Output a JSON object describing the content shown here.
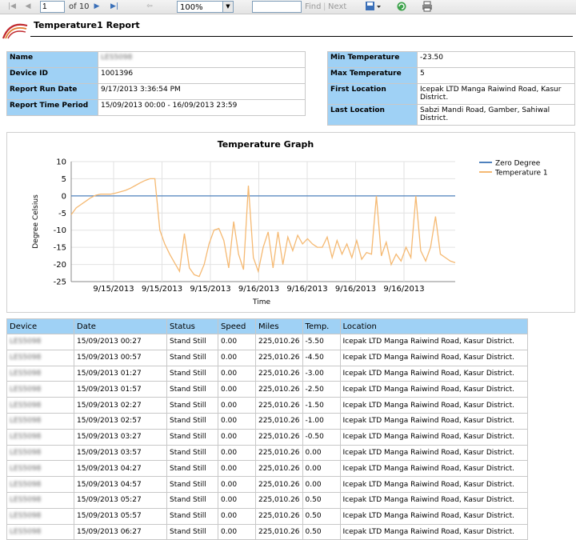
{
  "toolbar": {
    "page_value": "1",
    "page_of": "of 10",
    "zoom_value": "100%",
    "find_placeholder": "",
    "find_label": "Find",
    "separator": "|",
    "next_label": "Next"
  },
  "report": {
    "title": "Temperature1 Report"
  },
  "info_left": [
    {
      "label": "Name",
      "value": "LES5098"
    },
    {
      "label": "Device ID",
      "value": "1001396"
    },
    {
      "label": "Report Run Date",
      "value": "9/17/2013 3:36:54 PM"
    },
    {
      "label": "Report Time Period",
      "value": "15/09/2013 00:00 - 16/09/2013 23:59"
    }
  ],
  "info_right": [
    {
      "label": "Min Temperature",
      "value": "-23.50"
    },
    {
      "label": "Max Temperature",
      "value": "5"
    },
    {
      "label": "First Location",
      "value": "Icepak LTD Manga Raiwind Road, Kasur District."
    },
    {
      "label": "Last Location",
      "value": "Sabzi Mandi Road, Gamber, Sahiwal District."
    }
  ],
  "chart_data": {
    "type": "line",
    "title": "Temperature Graph",
    "xlabel": "Time",
    "ylabel": "Degree Celsius",
    "ylim": [
      -25,
      10
    ],
    "yticks": [
      10,
      5,
      0,
      -5,
      -10,
      -15,
      -20,
      -25
    ],
    "xtick_labels": [
      "9/15/2013",
      "9/15/2013",
      "9/15/2013",
      "9/16/2013",
      "9/16/2013",
      "9/16/2013",
      "9/16/2013"
    ],
    "legend_position": "top-right",
    "grid": true,
    "series": [
      {
        "name": "Zero Degree",
        "color": "#4f81bd",
        "values": [
          0,
          0
        ]
      },
      {
        "name": "Temperature 1",
        "color": "#f5b972",
        "values": [
          -5.5,
          -3.5,
          -2.5,
          -1.5,
          -0.5,
          0.2,
          0.5,
          0.5,
          0.5,
          0.8,
          1.2,
          1.6,
          2.2,
          3.0,
          3.8,
          4.5,
          5.0,
          5.0,
          -10.0,
          -14.0,
          -17.0,
          -19.5,
          -22.0,
          -11.0,
          -21.0,
          -23.0,
          -23.5,
          -20.0,
          -14.0,
          -10.0,
          -9.5,
          -13.0,
          -21.0,
          -7.5,
          -17.0,
          -21.5,
          3.0,
          -18.0,
          -22.0,
          -15.0,
          -10.5,
          -21.0,
          -10.5,
          -20.0,
          -12.0,
          -16.0,
          -11.5,
          -14.0,
          -12.5,
          -14.0,
          -15.0,
          -15.0,
          -12.0,
          -18.0,
          -13.0,
          -17.0,
          -14.0,
          -18.0,
          -13.0,
          -18.5,
          -16.5,
          -17.0,
          0.0,
          -17.5,
          -13.5,
          -20.0,
          -17.0,
          -19.0,
          -15.0,
          -18.0,
          0.0,
          -16.0,
          -19.0,
          -15.0,
          -6.0,
          -17.0,
          -18.0,
          -19.0,
          -19.5
        ]
      }
    ]
  },
  "table": {
    "headers": [
      "Device",
      "Date",
      "Status",
      "Speed",
      "Miles",
      "Temp.",
      "Location"
    ],
    "rows": [
      [
        "LES5098",
        "15/09/2013 00:27",
        "Stand Still",
        "0.00",
        "225,010.26",
        "-5.50",
        "Icepak LTD Manga Raiwind Road, Kasur District."
      ],
      [
        "LES5098",
        "15/09/2013 00:57",
        "Stand Still",
        "0.00",
        "225,010.26",
        "-4.50",
        "Icepak LTD Manga Raiwind Road, Kasur District."
      ],
      [
        "LES5098",
        "15/09/2013 01:27",
        "Stand Still",
        "0.00",
        "225,010.26",
        "-3.00",
        "Icepak LTD Manga Raiwind Road, Kasur District."
      ],
      [
        "LES5098",
        "15/09/2013 01:57",
        "Stand Still",
        "0.00",
        "225,010.26",
        "-2.50",
        "Icepak LTD Manga Raiwind Road, Kasur District."
      ],
      [
        "LES5098",
        "15/09/2013 02:27",
        "Stand Still",
        "0.00",
        "225,010.26",
        "-1.50",
        "Icepak LTD Manga Raiwind Road, Kasur District."
      ],
      [
        "LES5098",
        "15/09/2013 02:57",
        "Stand Still",
        "0.00",
        "225,010.26",
        "-1.00",
        "Icepak LTD Manga Raiwind Road, Kasur District."
      ],
      [
        "LES5098",
        "15/09/2013 03:27",
        "Stand Still",
        "0.00",
        "225,010.26",
        "-0.50",
        "Icepak LTD Manga Raiwind Road, Kasur District."
      ],
      [
        "LES5098",
        "15/09/2013 03:57",
        "Stand Still",
        "0.00",
        "225,010.26",
        "0.00",
        "Icepak LTD Manga Raiwind Road, Kasur District."
      ],
      [
        "LES5098",
        "15/09/2013 04:27",
        "Stand Still",
        "0.00",
        "225,010.26",
        "0.00",
        "Icepak LTD Manga Raiwind Road, Kasur District."
      ],
      [
        "LES5098",
        "15/09/2013 04:57",
        "Stand Still",
        "0.00",
        "225,010.26",
        "0.00",
        "Icepak LTD Manga Raiwind Road, Kasur District."
      ],
      [
        "LES5098",
        "15/09/2013 05:27",
        "Stand Still",
        "0.00",
        "225,010.26",
        "0.50",
        "Icepak LTD Manga Raiwind Road, Kasur District."
      ],
      [
        "LES5098",
        "15/09/2013 05:57",
        "Stand Still",
        "0.00",
        "225,010.26",
        "0.50",
        "Icepak LTD Manga Raiwind Road, Kasur District."
      ],
      [
        "LES5098",
        "15/09/2013 06:27",
        "Stand Still",
        "0.00",
        "225,010.26",
        "0.50",
        "Icepak LTD Manga Raiwind Road, Kasur District."
      ]
    ]
  }
}
